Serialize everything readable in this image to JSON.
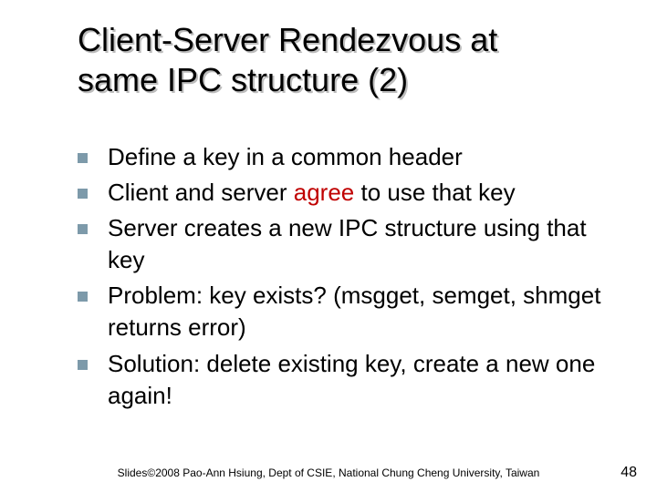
{
  "title_line1": "Client-Server Rendezvous at",
  "title_line2": "same IPC structure (2)",
  "bullets": [
    {
      "pre": "Define a key in a common header",
      "hl": "",
      "post": ""
    },
    {
      "pre": "Client and server ",
      "hl": "agree",
      "post": " to use that key"
    },
    {
      "pre": "Server creates a new IPC structure using that key",
      "hl": "",
      "post": ""
    },
    {
      "pre": "Problem: key exists? (msgget, semget, shmget returns error)",
      "hl": "",
      "post": ""
    },
    {
      "pre": "Solution: delete existing key, create a new one again!",
      "hl": "",
      "post": ""
    }
  ],
  "footer": "Slides©2008 Pao-Ann Hsiung, Dept of CSIE, National Chung Cheng University, Taiwan",
  "page": "48"
}
